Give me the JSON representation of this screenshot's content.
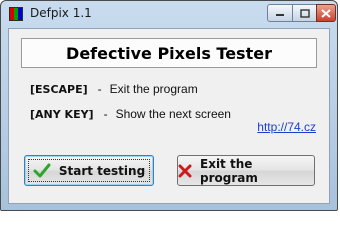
{
  "window": {
    "title": "Defpix 1.1",
    "controls": {
      "minimize": "minimize-icon",
      "maximize": "maximize-icon",
      "close": "close-icon"
    }
  },
  "app_icon": {
    "name": "defpix-app-icon",
    "colors": [
      "#d80000",
      "#00a000",
      "#0000d0"
    ]
  },
  "header": {
    "title": "Defective Pixels Tester"
  },
  "shortcuts": [
    {
      "key": "[ESCAPE]",
      "dash": "-",
      "desc": "Exit the program"
    },
    {
      "key": "[ANY KEY]",
      "dash": "-",
      "desc": "Show the next screen"
    }
  ],
  "link": {
    "text": "http://74.cz"
  },
  "buttons": {
    "start": {
      "label": "Start testing",
      "icon": "green-check-icon",
      "color": "#2da62d"
    },
    "exit": {
      "label": "Exit the program",
      "icon": "red-x-icon",
      "color": "#cc1a1a"
    }
  }
}
